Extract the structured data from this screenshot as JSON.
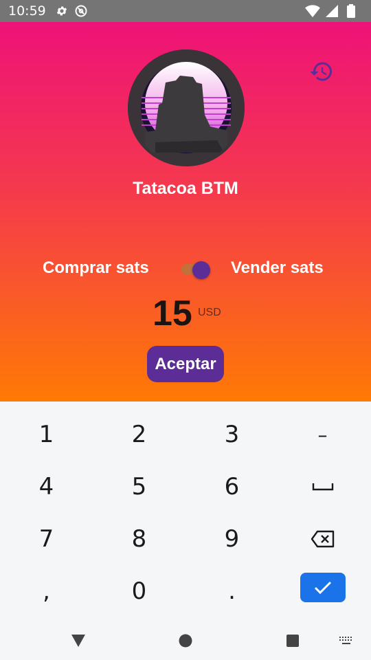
{
  "status_bar": {
    "time": "10:59",
    "left_icons": [
      "gear-icon",
      "at-sign-icon"
    ],
    "right_icons": [
      "wifi-icon",
      "signal-icon",
      "battery-icon"
    ]
  },
  "header": {
    "store_name": "Tatacoa BTM",
    "history_icon": "history-icon"
  },
  "trade": {
    "buy_label": "Comprar sats",
    "sell_label": "Vender sats",
    "toggle_on": true
  },
  "amount": {
    "value": "15",
    "currency": "USD"
  },
  "actions": {
    "accept_label": "Aceptar"
  },
  "keypad": {
    "rows": [
      [
        "1",
        "2",
        "3",
        "–"
      ],
      [
        "4",
        "5",
        "6",
        "space"
      ],
      [
        "7",
        "8",
        "9",
        "backspace"
      ],
      [
        ",",
        "0",
        ".",
        "done"
      ]
    ],
    "labels": {
      "k1": "1",
      "k2": "2",
      "k3": "3",
      "minus": "–",
      "k4": "4",
      "k5": "5",
      "k6": "6",
      "k7": "7",
      "k8": "8",
      "k9": "9",
      "comma": ",",
      "k0": "0",
      "dot": "."
    }
  },
  "colors": {
    "gradient_top": "#ee1278",
    "gradient_bottom": "#ff7a04",
    "accent_purple": "#5c2d96",
    "done_blue": "#1a73e8"
  }
}
